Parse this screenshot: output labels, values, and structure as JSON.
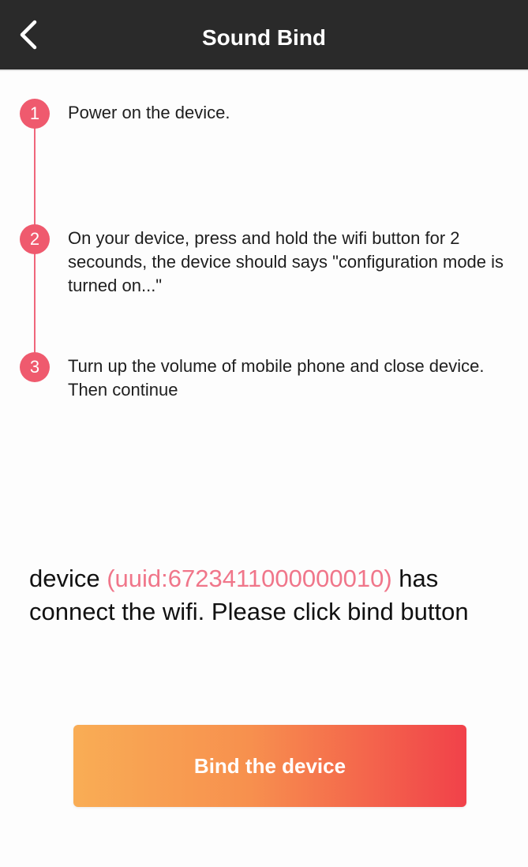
{
  "header": {
    "title": "Sound Bind",
    "back_icon": "chevron-left-icon"
  },
  "steps": [
    {
      "number": "1",
      "text": "Power on the device."
    },
    {
      "number": "2",
      "text": "On your device, press and hold the wifi button for 2 secounds, the device should says \"configuration mode is turned on...\""
    },
    {
      "number": "3",
      "text": "Turn up the volume of mobile phone and close device. Then continue"
    }
  ],
  "status": {
    "prefix": "device ",
    "uuid": "(uuid:6723411000000010)",
    "suffix": " has connect the wifi.  Please click bind button"
  },
  "bind_button": {
    "label": "Bind the device"
  },
  "colors": {
    "header_bg": "#2a2a2a",
    "accent": "#ef5a6e",
    "uuid": "#f0768a",
    "button_gradient_start": "#f9ad55",
    "button_gradient_end": "#f1414a"
  }
}
